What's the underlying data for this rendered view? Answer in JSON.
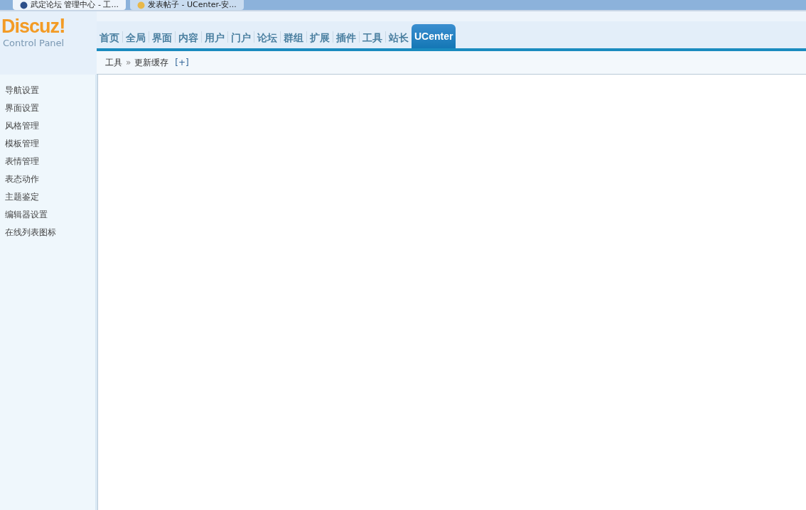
{
  "browser_tabs": [
    {
      "title": "武定论坛 管理中心 - 工...",
      "selected": true
    },
    {
      "title": "发表帖子 - UCenter-安...",
      "selected": false
    }
  ],
  "logo": {
    "name": "Discuz",
    "mark": "!",
    "subtitle": "Control Panel"
  },
  "nav": [
    {
      "label": "首页",
      "selected": false
    },
    {
      "label": "全局",
      "selected": false
    },
    {
      "label": "界面",
      "selected": false
    },
    {
      "label": "内容",
      "selected": false
    },
    {
      "label": "用户",
      "selected": false
    },
    {
      "label": "门户",
      "selected": false
    },
    {
      "label": "论坛",
      "selected": false
    },
    {
      "label": "群组",
      "selected": false
    },
    {
      "label": "扩展",
      "selected": false
    },
    {
      "label": "插件",
      "selected": false
    },
    {
      "label": "工具",
      "selected": false
    },
    {
      "label": "站长",
      "selected": false
    },
    {
      "label": "UCenter",
      "selected": true
    }
  ],
  "breadcrumb": {
    "section": "工具",
    "separator": "»",
    "page": "更新缓存",
    "add": "[+]"
  },
  "sidebar": {
    "items": [
      "导航设置",
      "界面设置",
      "风格管理",
      "模板管理",
      "表情管理",
      "表态动作",
      "主题鉴定",
      "编辑器设置",
      "在线列表图标"
    ]
  }
}
